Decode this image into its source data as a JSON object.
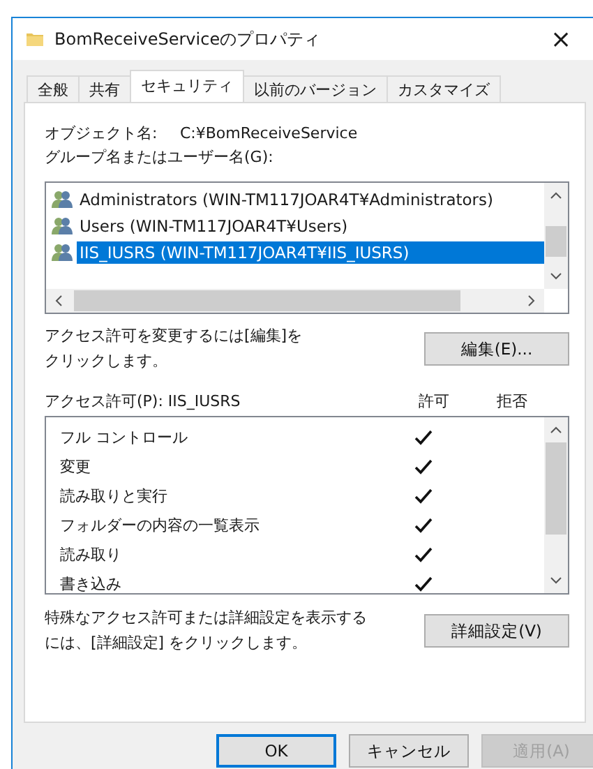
{
  "window": {
    "title": "BomReceiveServiceのプロパティ",
    "close": "×"
  },
  "tabs": [
    {
      "label": "全般",
      "selected": false
    },
    {
      "label": "共有",
      "selected": false
    },
    {
      "label": "セキュリティ",
      "selected": true
    },
    {
      "label": "以前のバージョン",
      "selected": false
    },
    {
      "label": "カスタマイズ",
      "selected": false
    }
  ],
  "object_name": {
    "label": "オブジェクト名:",
    "value": "C:¥BomReceiveService"
  },
  "groups_label": "グループ名またはユーザー名(G):",
  "groups": [
    {
      "name": "Administrators (WIN-TM117JOAR4T¥Administrators)",
      "selected": false
    },
    {
      "name": "Users (WIN-TM117JOAR4T¥Users)",
      "selected": false
    },
    {
      "name": "IIS_IUSRS (WIN-TM117JOAR4T¥IIS_IUSRS)",
      "selected": true
    }
  ],
  "edit_hint": "アクセス許可を変更するには[編集]をクリックします。",
  "edit_button": "編集(E)...",
  "permissions": {
    "label": "アクセス許可(P): IIS_IUSRS",
    "allow_header": "許可",
    "deny_header": "拒否",
    "rows": [
      {
        "name": "フル コントロール",
        "allow": true,
        "deny": false
      },
      {
        "name": "変更",
        "allow": true,
        "deny": false
      },
      {
        "name": "読み取りと実行",
        "allow": true,
        "deny": false
      },
      {
        "name": "フォルダーの内容の一覧表示",
        "allow": true,
        "deny": false
      },
      {
        "name": "読み取り",
        "allow": true,
        "deny": false
      },
      {
        "name": "書き込み",
        "allow": true,
        "deny": false
      }
    ]
  },
  "advanced_hint": "特殊なアクセス許可または詳細設定を表示するには、[詳細設定] をクリックします。",
  "advanced_button": "詳細設定(V)",
  "buttons": [
    {
      "label": "OK",
      "disabled": false
    },
    {
      "label": "キャンセル",
      "disabled": false
    },
    {
      "label": "適用(A)",
      "disabled": true
    }
  ]
}
